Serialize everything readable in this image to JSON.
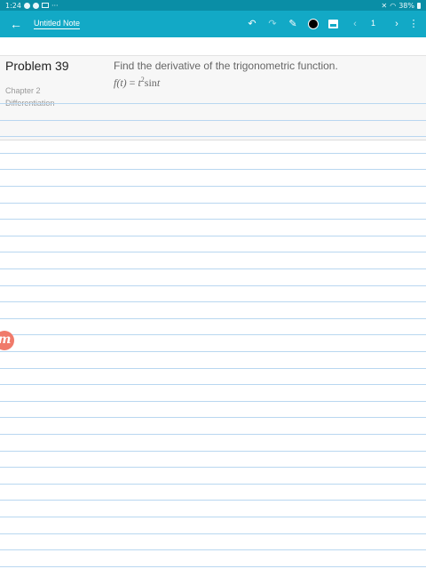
{
  "status_bar": {
    "time": "1:24",
    "more": "···",
    "battery": "38%"
  },
  "app_bar": {
    "title": "Untitled Note",
    "page_number": "1",
    "colors": {
      "accent": "#12a9c6",
      "status": "#0a8ea6",
      "pen_color": "#000000"
    },
    "icons": [
      "back-arrow-icon",
      "undo-icon",
      "redo-icon",
      "pen-icon",
      "color-swatch-icon",
      "image-icon",
      "prev-page-icon",
      "next-page-icon",
      "more-vert-icon"
    ]
  },
  "problem": {
    "title": "Problem 39",
    "chapter": "Chapter 2",
    "section": "Differentiation",
    "question": "Find the derivative of the trigonometric function.",
    "formula": {
      "lhs": "f(t)",
      "equals": "=",
      "base": "t",
      "exponent": "2",
      "rest": "sin",
      "var": "t"
    }
  },
  "watermark": {
    "logo_letter": "m"
  }
}
